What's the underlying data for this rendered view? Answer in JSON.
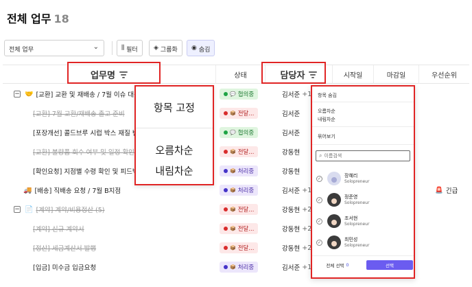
{
  "page": {
    "title": "전체 업무",
    "count": "18"
  },
  "toolbar": {
    "view_select": "전체 업무",
    "filter_label": "필터",
    "group_label": "그룹화",
    "hide_label": "숨김"
  },
  "columns": {
    "task": "업무명",
    "status": "상태",
    "assignee": "담당자",
    "start": "시작일",
    "due": "마감일",
    "priority": "우선순위"
  },
  "rows": [
    {
      "task": "[교환] 교환 및 재배송 / 7월 이슈 대응",
      "status": "협의중",
      "assignee": "김서준",
      "plus": "+1"
    },
    {
      "task": "[교환] 7월 교환/재배송 출고 준비",
      "status": "전달...",
      "assignee": "김서준",
      "plus": ""
    },
    {
      "task": "[포장개선] 콜드브루 시럽 박스 재질 변경",
      "status": "협의중",
      "assignee": "김서준",
      "plus": ""
    },
    {
      "task": "[교환] 불량품 회수 여부 및 일정 확인",
      "status": "전달...",
      "assignee": "강동현",
      "plus": ""
    },
    {
      "task": "[확인요청] 지점별 수령 확인 및 피드백",
      "status": "처리중",
      "assignee": "강동현",
      "plus": ""
    },
    {
      "task": "[배송] 직배송 요청 / 7월 B지점",
      "status": "처리중",
      "assignee": "김서준",
      "plus": "+1",
      "priority": "긴급"
    },
    {
      "task": "[계약] 계약/비용정산 (5)",
      "status": "전달...",
      "assignee": "강동현",
      "plus": "+2"
    },
    {
      "task": "[계약] 신규 계약서",
      "status": "전달...",
      "assignee": "강동현",
      "plus": "+2"
    },
    {
      "task": "[정산] 세금계산서 발행",
      "status": "전달...",
      "assignee": "강동현",
      "plus": "+2"
    },
    {
      "task": "[입금] 미수금 입금요청",
      "status": "처리중",
      "assignee": "김서준",
      "plus": "+1"
    }
  ],
  "column_menu": {
    "pin": "항목 고정",
    "asc": "오름차순",
    "desc": "내림차순"
  },
  "assignee_panel": {
    "hide": "항목 숨김",
    "asc": "오름차순",
    "desc": "내림차순",
    "group": "묶어보기",
    "search_placeholder": "이름검색",
    "users": [
      {
        "name": "장혜리",
        "org": "Solopreneur"
      },
      {
        "name": "정준영",
        "org": "Solopreneur"
      },
      {
        "name": "조서현",
        "org": "Solopreneur"
      },
      {
        "name": "최민성",
        "org": "Solopreneur"
      }
    ],
    "clear_label": "전체 선택",
    "clear_count": "0",
    "select_label": "선택"
  },
  "colors": {
    "highlight": "#e02424",
    "status_negotiating_bg": "#dff5df",
    "status_delivering_bg": "#fde8e8",
    "status_processing_bg": "#ece6fb",
    "accent": "#6b5cf0"
  }
}
